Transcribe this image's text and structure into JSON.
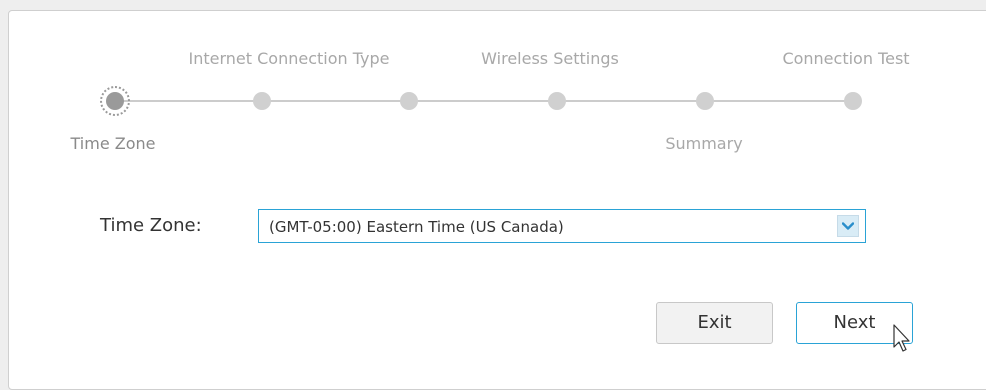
{
  "wizard": {
    "steps": [
      {
        "label": "Time Zone",
        "position": "bottom",
        "active": true
      },
      {
        "label": "Internet Connection Type",
        "position": "top",
        "active": false
      },
      {
        "label": "Wireless Settings",
        "position": "top",
        "active": false
      },
      {
        "label": "Summary",
        "position": "bottom",
        "active": false
      },
      {
        "label": "Connection Test",
        "position": "top",
        "active": false
      }
    ],
    "current_step": 1,
    "total_step_dots": 6
  },
  "form": {
    "timezone_label": "Time Zone:",
    "timezone_value": "(GMT-05:00) Eastern Time (US Canada)"
  },
  "buttons": {
    "exit_label": "Exit",
    "next_label": "Next"
  },
  "colors": {
    "accent": "#2aa3d6",
    "step_inactive": "#d0d0d0",
    "step_active": "#9a9a9a"
  },
  "icons": {
    "select_arrow": "chevron-down-icon",
    "cursor": "pointer-cursor-icon"
  }
}
